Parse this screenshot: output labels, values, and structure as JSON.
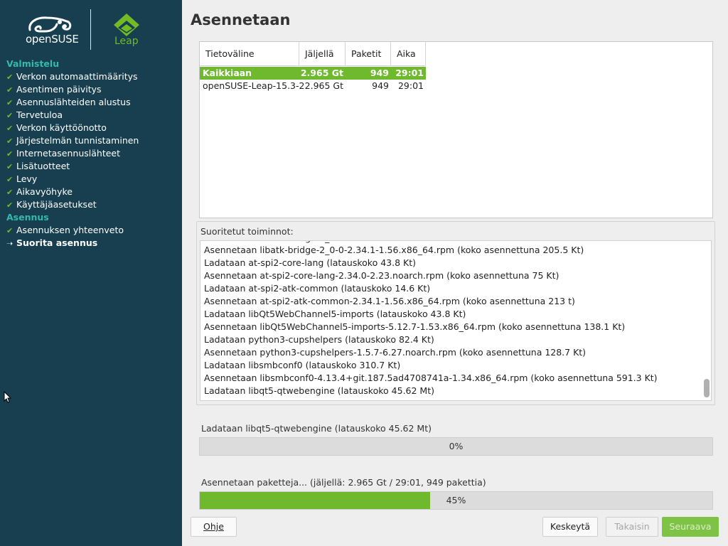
{
  "sidebar": {
    "brand": "openSUSE",
    "product": "Leap",
    "sections": [
      {
        "title": "Valmistelu",
        "items": [
          "Verkon automaattimääritys",
          "Asentimen päivitys",
          "Asennuslähteiden alustus",
          "Tervetuloa",
          "Verkon käyttöönotto",
          "Järjestelmän tunnistaminen",
          "Internetasennuslähteet",
          "Lisätuotteet",
          "Levy",
          "Aikavyöhyke",
          "Käyttäjäasetukset"
        ]
      },
      {
        "title": "Asennus",
        "items": [
          "Asennuksen yhteenveto"
        ],
        "current": "Suorita asennus"
      }
    ]
  },
  "main": {
    "title": "Asennetaan",
    "media_table": {
      "headers": [
        "Tietoväline",
        "Jäljellä",
        "Paketit",
        "Aika"
      ],
      "rows": [
        {
          "medium": "Kaikkiaan",
          "remaining": "2.965 Gt",
          "packages": "949",
          "time": "29:01",
          "selected": true
        },
        {
          "medium": "openSUSE-Leap-15.3-2",
          "remaining": "2.965 Gt",
          "packages": "949",
          "time": "29:01",
          "selected": false
        }
      ]
    },
    "log": {
      "label": "Suoritetut toiminnot:",
      "lines": [
        "Asennetaan libatk-bridge-2_0-0-2.34.1-1.56.x86_64.rpm (koko asennettuna 205.5 Kt)",
        "Ladataan at-spi2-core-lang (latauskoko 43.8 Kt)",
        "Asennetaan at-spi2-core-lang-2.34.0-2.23.noarch.rpm (koko asennettuna 75 Kt)",
        "Ladataan at-spi2-atk-common (latauskoko 14.6 Kt)",
        "Asennetaan at-spi2-atk-common-2.34.1-1.56.x86_64.rpm (koko asennettuna 213 t)",
        "Ladataan libQt5WebChannel5-imports (latauskoko 43.8 Kt)",
        "Asennetaan libQt5WebChannel5-imports-5.12.7-1.53.x86_64.rpm (koko asennettuna 138.1 Kt)",
        "Ladataan python3-cupshelpers (latauskoko 82.4 Kt)",
        "Asennetaan python3-cupshelpers-1.5.7-6.27.noarch.rpm (koko asennettuna 128.7 Kt)",
        "Ladataan libsmbconf0 (latauskoko 310.7 Kt)",
        "Asennetaan libsmbconf0-4.13.4+git.187.5ad4708741a-1.34.x86_64.rpm (koko asennettuna 591.3 Kt)",
        "Ladataan libqt5-qtwebengine (latauskoko 45.62 Mt)"
      ]
    },
    "download": {
      "label": "Ladataan libqt5-qtwebengine (latauskoko 45.62 Mt)",
      "percent_text": "0%",
      "fraction": 0.0
    },
    "install": {
      "label": "Asennetaan paketteja... (jäljellä: 2.965 Gt / 29:01, 949 pakettia)",
      "percent_text": "45%",
      "fraction": 0.45
    }
  },
  "buttons": {
    "help": "Ohje",
    "abort": "Keskeytä",
    "back": "Takaisin",
    "next": "Seuraava"
  },
  "colors": {
    "sidebar_bg": "#173f4f",
    "section_title": "#35b9ab",
    "accent_green": "#6eb92e"
  }
}
